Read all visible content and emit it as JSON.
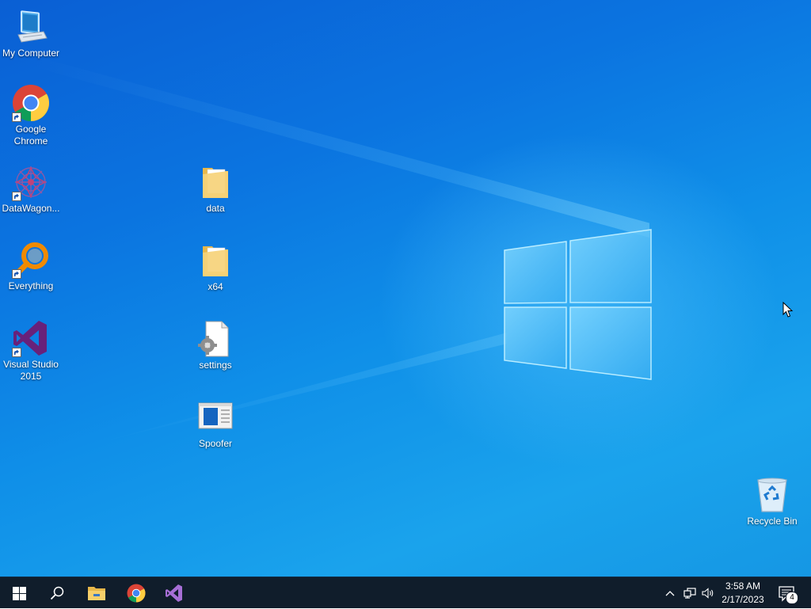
{
  "desktop_icons": [
    {
      "label": "My Computer",
      "icon": "computer-icon"
    },
    {
      "label": "Google Chrome",
      "icon": "chrome-icon",
      "shortcut": true
    },
    {
      "label": "DataWagon...",
      "icon": "datawagon-icon",
      "shortcut": true
    },
    {
      "label": "Everything",
      "icon": "everything-search-icon",
      "shortcut": true
    },
    {
      "label": "Visual Studio 2015",
      "icon": "visual-studio-icon",
      "shortcut": true
    },
    {
      "label": "data",
      "icon": "folder-icon"
    },
    {
      "label": "x64",
      "icon": "folder-icon"
    },
    {
      "label": "settings",
      "icon": "settings-file-icon"
    },
    {
      "label": "Spoofer",
      "icon": "application-window-icon"
    },
    {
      "label": "Recycle Bin",
      "icon": "recycle-bin-icon"
    }
  ],
  "taskbar": {
    "buttons": [
      "windows-start-icon",
      "search-icon",
      "file-explorer-icon",
      "chrome-icon",
      "visual-studio-icon"
    ],
    "tray": [
      "chevron-up-icon",
      "network-icon",
      "volume-icon"
    ],
    "clock": {
      "time": "3:58 AM",
      "date": "2/17/2023"
    },
    "notifications": "4"
  },
  "colors": {
    "wallpaper_blue": "#0b74e0",
    "taskbar": "#101d2b",
    "vs_purple": "#68217a",
    "everything_orange": "#f08a00"
  }
}
